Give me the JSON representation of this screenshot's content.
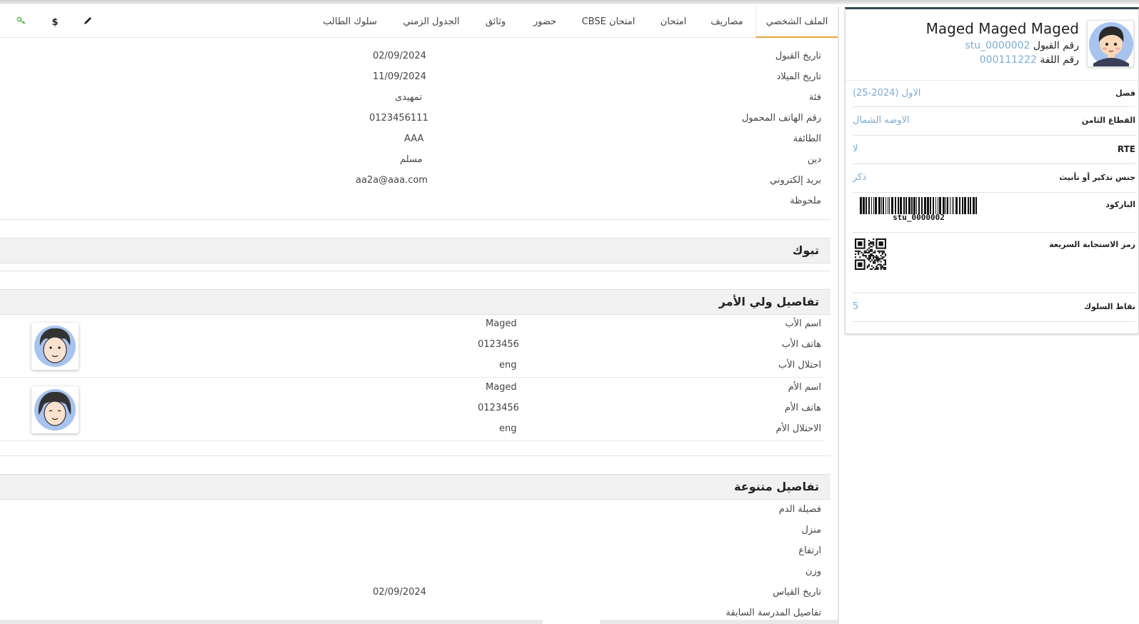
{
  "student": {
    "name": "Maged Maged Maged",
    "admission_label": "رقم القبول",
    "admission_no": "stu_0000002",
    "roll_label": "رقم اللفة",
    "roll_no": "000111222"
  },
  "card_rows": [
    {
      "label": "فصل",
      "value": "الاول (2024-25)"
    },
    {
      "label": "القطاع الثامن",
      "value": "الاوضه الشمال"
    },
    {
      "label": "RTE",
      "value": "لا"
    },
    {
      "label": "جنس تذكير أو تأنيث",
      "value": "ذكر"
    }
  ],
  "barcode": {
    "label": "الباركود",
    "text": "stu_0000002"
  },
  "qr": {
    "label": "رمز الاستجابة السريعة"
  },
  "behaviour": {
    "label": "نقاط السلوك",
    "value": "5"
  },
  "tabs": [
    "الملف الشخصي",
    "مصاريف",
    "امتحان",
    "امتحان CBSE",
    "حضور",
    "وثائق",
    "الجدول الزمني",
    "سلوك الطالب"
  ],
  "tool_icons": [
    "edit-icon",
    "dollar-icon",
    "key-icon"
  ],
  "profile_rows": [
    {
      "label": "تاريخ القبول",
      "value": "02/09/2024"
    },
    {
      "label": "تاريخ الميلاد",
      "value": "11/09/2024"
    },
    {
      "label": "فئة",
      "value": "تمهيدى"
    },
    {
      "label": "رقم الهاتف المحمول",
      "value": "0123456111"
    },
    {
      "label": "الطائفة",
      "value": "AAA"
    },
    {
      "label": "دين",
      "value": "مسلم"
    },
    {
      "label": "بريد إلكتروني",
      "value": "aa2a@aaa.com"
    },
    {
      "label": "ملحوظة",
      "value": ""
    }
  ],
  "tabuk": {
    "title": "تبوك"
  },
  "guardian": {
    "title": "تفاصيل ولي الأمر",
    "father": [
      {
        "label": "اسم الأب",
        "value": "Maged"
      },
      {
        "label": "هاتف الأب",
        "value": "0123456"
      },
      {
        "label": "احتلال الأب",
        "value": "eng"
      }
    ],
    "mother": [
      {
        "label": "اسم الأم",
        "value": "Maged"
      },
      {
        "label": "هاتف الأم",
        "value": "0123456"
      },
      {
        "label": "الاحتلال الأم",
        "value": "eng"
      }
    ]
  },
  "misc": {
    "title": "تفاصيل متنوعة",
    "rows": [
      {
        "label": "فصيلة الدم",
        "value": ""
      },
      {
        "label": "منزل",
        "value": ""
      },
      {
        "label": "ارتفاع",
        "value": ""
      },
      {
        "label": "وزن",
        "value": ""
      },
      {
        "label": "تاريخ القياس",
        "value": "02/09/2024"
      },
      {
        "label": "تفاصيل المدرسة السابقة",
        "value": ""
      }
    ]
  },
  "colors": {
    "accent_tab": "#e8a33c",
    "link_value": "#7bacd2",
    "key_icon": "#5cb85c"
  }
}
